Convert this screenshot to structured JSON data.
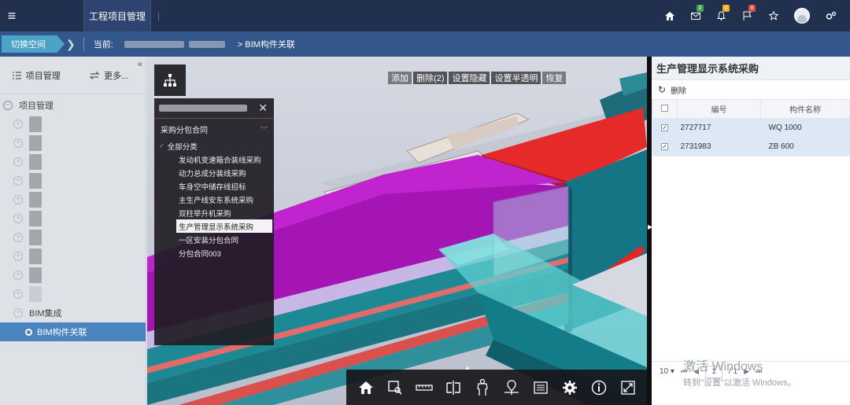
{
  "topbar": {
    "active_tab": "工程项目管理",
    "separator": "|",
    "badges": {
      "mail": "2",
      "bell": "0",
      "flag": "8"
    },
    "colors": {
      "mail_badge": "#3fae49",
      "bell_badge": "#f0ad1c",
      "flag_badge": "#e14b3b",
      "bar": "#223050"
    },
    "icons": [
      "home-icon",
      "mail-icon",
      "bell-icon",
      "flag-icon",
      "star-icon",
      "avatar",
      "settings-icon"
    ]
  },
  "breadcrumb": {
    "switch_label": "切换空间",
    "current_label": "当前:",
    "current_page": "> BIM构件关联"
  },
  "sidebar": {
    "tab_project": "项目管理",
    "tab_more": "更多...",
    "collapse": "«",
    "root_label": "项目管理",
    "bim_group": "BIM集成",
    "bim_active": "BIM构件关联"
  },
  "viewer": {
    "toolbar": {
      "add": "添加",
      "delete": "删除(2)",
      "set_hidden": "设置隐藏",
      "set_translucent": "设置半透明",
      "restore": "恢复"
    },
    "class_panel": {
      "close": "✕",
      "contract": "采购分包合同",
      "all": "全部分类",
      "items": [
        "发动机变速箱合装线采购",
        "动力总成分装线采购",
        "车身空中储存线招标",
        "主生产线安东系统采购",
        "双柱举升机采购",
        "生产管理显示系统采购",
        "一区安装分包合同",
        "分包合同003"
      ],
      "selected_index": 5
    },
    "bottom_tools": [
      "home-icon",
      "zoom-box-icon",
      "measure-icon",
      "section-icon",
      "person-icon",
      "location-icon",
      "properties-icon",
      "settings-icon",
      "info-icon",
      "fullscreen-icon"
    ]
  },
  "right_panel": {
    "title": "生产管理显示系统采购",
    "delete": "删除",
    "columns": {
      "code": "编号",
      "name": "构件名称"
    },
    "rows": [
      {
        "code": "2727717",
        "name": "WQ 1000",
        "checked": true
      },
      {
        "code": "2731983",
        "name": "ZB 600",
        "checked": true
      }
    ],
    "pager": {
      "page_size": "10",
      "page": "1",
      "total": "/ 1"
    }
  },
  "watermark": {
    "line1": "激活 Windows",
    "line2": "转到\"设置\"以激活 Windows。"
  }
}
